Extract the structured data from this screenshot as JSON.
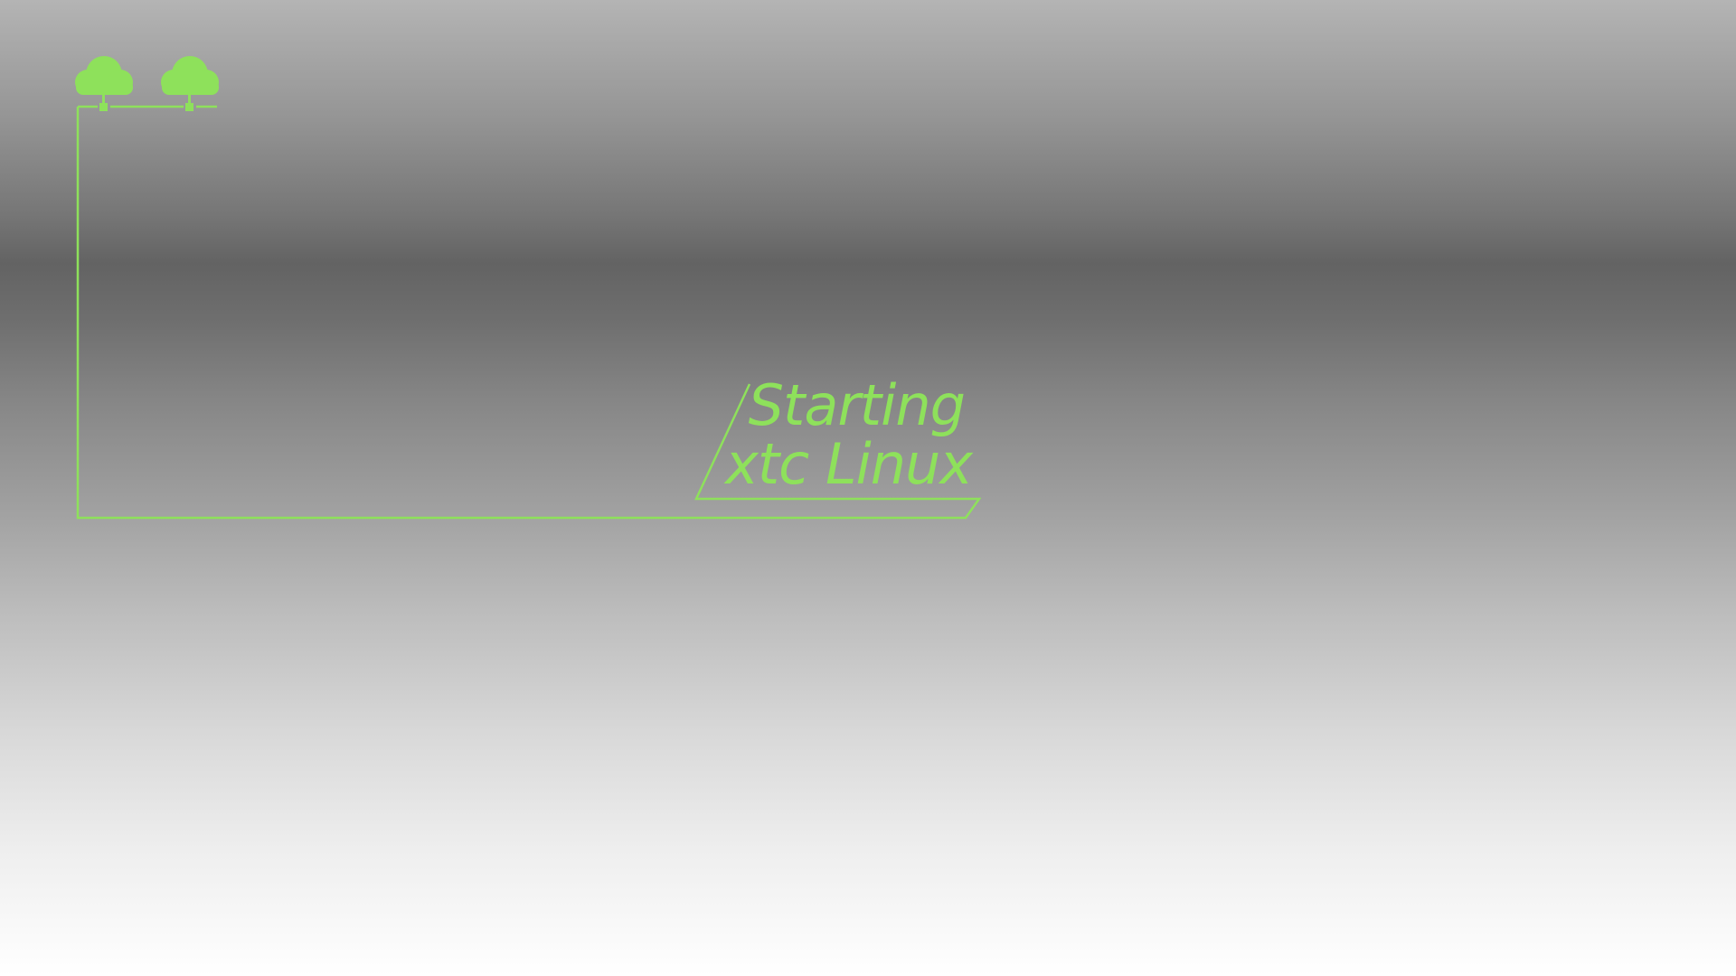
{
  "boot_screen": {
    "line1": "Starting",
    "line2": "xtc Linux"
  },
  "icons": [
    "cloud-network-icon",
    "cloud-network-icon"
  ],
  "colors": {
    "accent": "#8ee15b"
  }
}
